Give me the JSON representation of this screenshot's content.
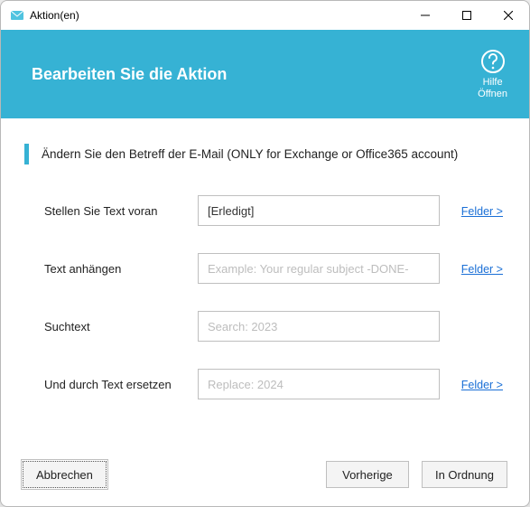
{
  "window": {
    "title": "Aktion(en)"
  },
  "banner": {
    "title": "Bearbeiten Sie die Aktion",
    "help_line1": "Hilfe",
    "help_line2": "Öffnen"
  },
  "instruction": "Ändern Sie den Betreff der E-Mail (ONLY for Exchange or Office365 account)",
  "fields_link": "Felder >",
  "form": {
    "prefix": {
      "label": "Stellen Sie Text voran",
      "value": "[Erledigt]",
      "placeholder": ""
    },
    "append": {
      "label": "Text anhängen",
      "value": "",
      "placeholder": "Example: Your regular subject -DONE-"
    },
    "search": {
      "label": "Suchtext",
      "value": "",
      "placeholder": "Search: 2023"
    },
    "replace": {
      "label": "Und durch Text ersetzen",
      "value": "",
      "placeholder": "Replace: 2024"
    }
  },
  "buttons": {
    "cancel": "Abbrechen",
    "previous": "Vorherige",
    "ok": "In Ordnung"
  }
}
